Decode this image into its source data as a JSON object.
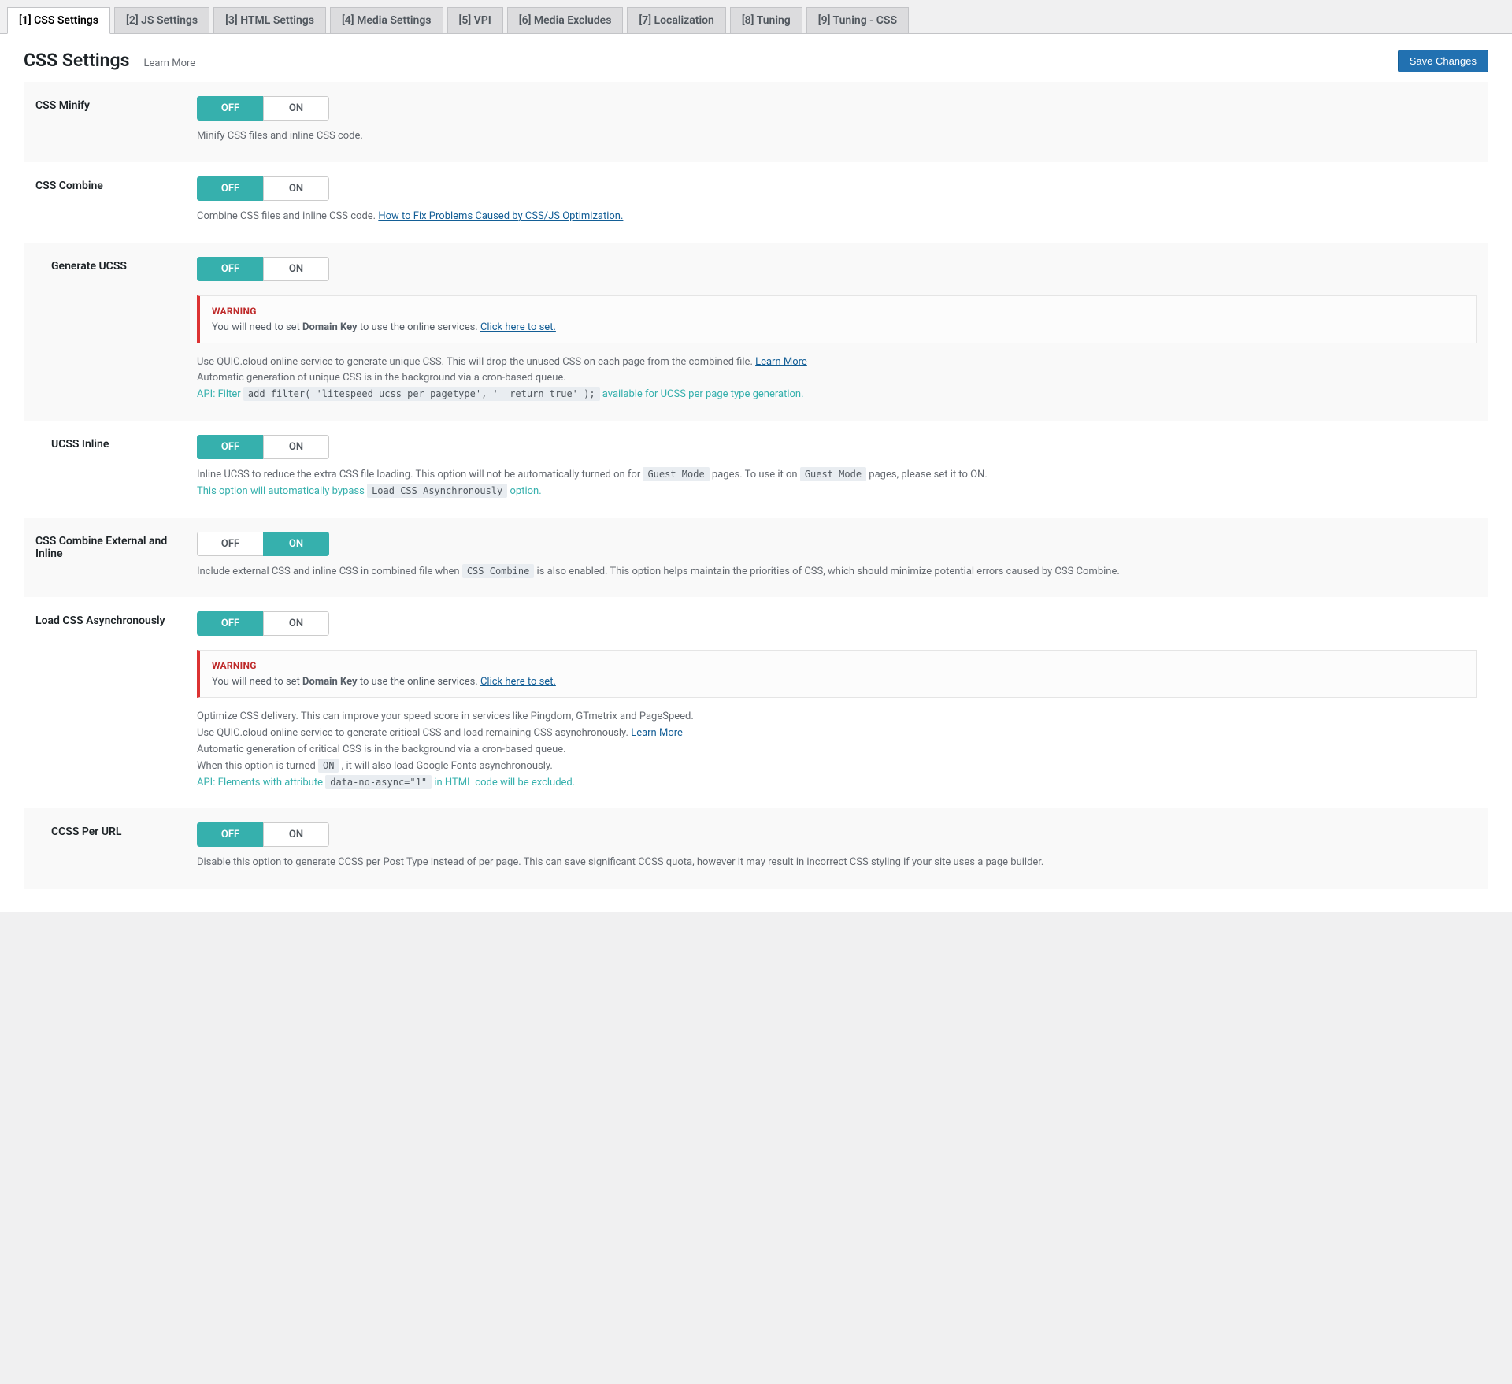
{
  "tabs": {
    "css": "[1] CSS Settings",
    "js": "[2] JS Settings",
    "html": "[3] HTML Settings",
    "media": "[4] Media Settings",
    "vpi": "[5] VPI",
    "excludes": "[6] Media Excludes",
    "localization": "[7] Localization",
    "tuning": "[8] Tuning",
    "tuningcss": "[9] Tuning - CSS"
  },
  "header": {
    "title": "CSS Settings",
    "learn_more": "Learn More",
    "save_btn": "Save Changes"
  },
  "toggle": {
    "off": "OFF",
    "on": "ON"
  },
  "warning": {
    "title": "WARNING",
    "prefix": "You will need to set ",
    "bold": "Domain Key",
    "suffix": " to use the online services. ",
    "link": "Click here to set."
  },
  "rows": {
    "minify": {
      "label": "CSS Minify",
      "desc": "Minify CSS files and inline CSS code."
    },
    "combine": {
      "label": "CSS Combine",
      "desc": "Combine CSS files and inline CSS code. ",
      "link": "How to Fix Problems Caused by CSS/JS Optimization."
    },
    "ucss": {
      "label": "Generate UCSS",
      "desc1": "Use QUIC.cloud online service to generate unique CSS. This will drop the unused CSS on each page from the combined file. ",
      "learn": "Learn More",
      "desc2": "Automatic generation of unique CSS is in the background via a cron-based queue.",
      "api_label": "API: Filter ",
      "api_code": "add_filter( 'litespeed_ucss_per_pagetype', '__return_true' );",
      "api_suffix": " available for UCSS per page type generation."
    },
    "ucss_inline": {
      "label": "UCSS Inline",
      "d1": "Inline UCSS to reduce the extra CSS file loading. This option will not be automatically turned on for ",
      "code1": "Guest Mode",
      "d2": " pages. To use it on ",
      "code2": "Guest Mode",
      "d3": " pages, please set it to ON.",
      "green1": "This option will automatically bypass ",
      "green_code": "Load CSS Asynchronously",
      "green2": " option."
    },
    "combine_ext": {
      "label": "CSS Combine External and Inline",
      "d1": "Include external CSS and inline CSS in combined file when ",
      "code": "CSS Combine",
      "d2": " is also enabled. This option helps maintain the priorities of CSS, which should minimize potential errors caused by CSS Combine."
    },
    "async": {
      "label": "Load CSS Asynchronously",
      "d1": "Optimize CSS delivery. This can improve your speed score in services like Pingdom, GTmetrix and PageSpeed.",
      "d2": "Use QUIC.cloud online service to generate critical CSS and load remaining CSS asynchronously. ",
      "learn": "Learn More",
      "d3": "Automatic generation of critical CSS is in the background via a cron-based queue.",
      "d4a": "When this option is turned ",
      "d4code": "ON",
      "d4b": " , it will also load Google Fonts asynchronously.",
      "api_label": "API: Elements with attribute ",
      "api_code": "data-no-async=\"1\"",
      "api_suffix": " in HTML code will be excluded."
    },
    "ccss": {
      "label": "CCSS Per URL",
      "desc": "Disable this option to generate CCSS per Post Type instead of per page. This can save significant CCSS quota, however it may result in incorrect CSS styling if your site uses a page builder."
    }
  }
}
